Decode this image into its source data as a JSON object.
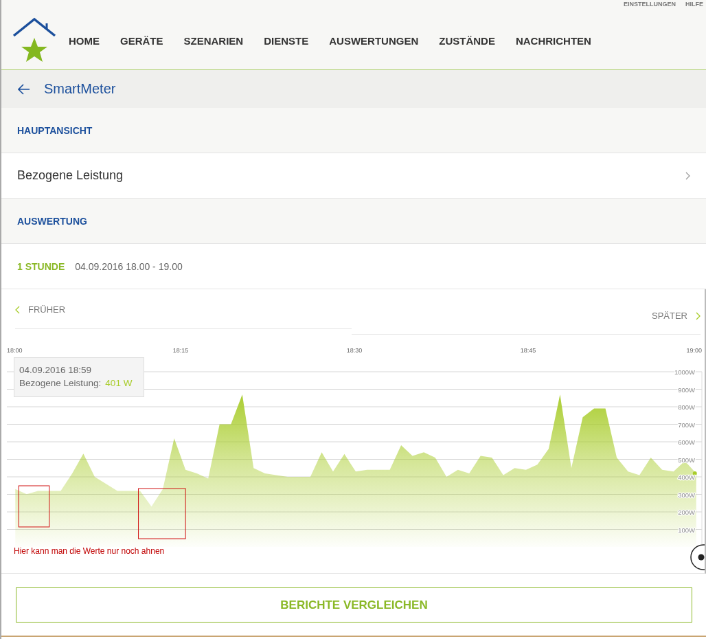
{
  "header": {
    "top_links": [
      "EINSTELLUNGEN",
      "HILFE"
    ],
    "nav": [
      "HOME",
      "GERÄTE",
      "SZENARIEN",
      "DIENSTE",
      "AUSWERTUNGEN",
      "ZUSTÄNDE",
      "NACHRICHTEN"
    ]
  },
  "page_title": "SmartMeter",
  "sections": [
    {
      "heading": "HAUPTANSICHT",
      "rows": [
        {
          "kind": "link",
          "label": "Bezogene Leistung"
        }
      ]
    },
    {
      "heading": "AUSWERTUNG",
      "rows": [
        {
          "kind": "range",
          "period": "1 STUNDE",
          "range": "04.09.2016 18.00 - 19.00"
        }
      ]
    }
  ],
  "chart_panel": {
    "earlier": "FRÜHER",
    "later": "SPÄTER",
    "tooltip": {
      "time": "04.09.2016 18:59",
      "label": "Bezogene Leistung:",
      "value": "401 W"
    },
    "chart_data": {
      "type": "area",
      "categories": [
        "18:00",
        null,
        null,
        null,
        null,
        null,
        null,
        null,
        null,
        null,
        null,
        null,
        null,
        null,
        null,
        "18:15",
        null,
        null,
        null,
        null,
        null,
        null,
        null,
        null,
        null,
        null,
        null,
        null,
        null,
        null,
        "18:30",
        null,
        null,
        null,
        null,
        null,
        null,
        null,
        null,
        null,
        null,
        null,
        null,
        null,
        null,
        "18:45",
        null,
        null,
        null,
        null,
        null,
        null,
        null,
        null,
        null,
        null,
        null,
        null,
        null,
        null,
        "19:00"
      ],
      "series": [
        {
          "color": "#a8cc2a",
          "values": [
            330,
            301,
            320,
            320,
            320,
            418,
            532,
            400,
            360,
            320,
            320,
            320,
            230,
            330,
            620,
            440,
            420,
            390,
            700,
            700,
            870,
            450,
            420,
            410,
            400,
            400,
            400,
            540,
            430,
            530,
            430,
            440,
            440,
            440,
            580,
            520,
            540,
            510,
            400,
            440,
            420,
            520,
            510,
            410,
            450,
            440,
            470,
            560,
            870,
            450,
            740,
            790,
            790,
            510,
            430,
            410,
            510,
            440,
            430,
            490,
            420
          ]
        }
      ],
      "ylim": [
        0,
        1000
      ],
      "grid": true,
      "yticks": [
        {
          "value": 100,
          "label": "100W"
        },
        {
          "value": 200,
          "label": "200W"
        },
        {
          "value": 300,
          "label": "300W"
        },
        {
          "value": 400,
          "label": "400W"
        },
        {
          "value": 500,
          "label": "500W"
        },
        {
          "value": 600,
          "label": "600W"
        },
        {
          "value": 700,
          "label": "700W"
        },
        {
          "value": 800,
          "label": "800W"
        },
        {
          "value": 900,
          "label": "900W"
        },
        {
          "value": 1000,
          "label": "1000W"
        }
      ],
      "annotations": [
        "Hier kann man die Werte nur noch ahnen"
      ]
    }
  },
  "button": "BERICHTE VERGLEICHEN"
}
